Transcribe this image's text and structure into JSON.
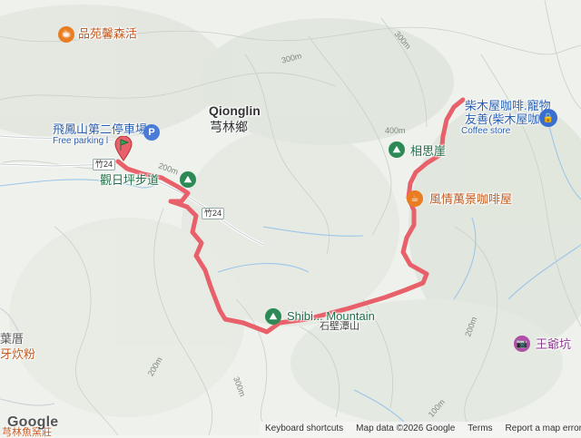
{
  "map": {
    "place_name_en": "Qionglin",
    "place_name_zh": "芎林鄉",
    "pois": {
      "cafe_top_left": "品苑馨森活",
      "parking_zh": "飛鳳山第二停車場",
      "parking_en": "Free parking l",
      "viewpoint": "觀日坪步道",
      "xiangsi": "相思崖",
      "cafe_right": "風情萬景咖啡屋",
      "coffee_store_zh_1": "柴木屋咖啡.寵物",
      "coffee_store_zh_2": "友善(柴木屋咖啡)",
      "coffee_store_en": "Coffee store",
      "mountain_en": "Shibi... Mountain",
      "mountain_zh": "石壁潭山",
      "temple": "王爺坑",
      "left_edge_1": "葉厝",
      "left_edge_2": "牙炊粉",
      "bottom_left": "芎林魚窯莊"
    },
    "roads": {
      "shield_1": "竹24",
      "shield_2": "竹24"
    },
    "contours": [
      "300m",
      "300m",
      "400m",
      "200m",
      "200m",
      "300m",
      "200m",
      "100m"
    ],
    "icons": {
      "cafe": "coffee-cup-icon",
      "parking": "parking-icon",
      "hiking": "hiking-icon",
      "shop": "shopping-bag-icon",
      "camera": "camera-icon",
      "start": "start-flag-icon"
    },
    "colors": {
      "route": "#e8606a",
      "cafe": "#e87d22",
      "hiking": "#2d8a57",
      "parking": "#4a7bd6",
      "shop": "#3a6fd0",
      "camera": "#b04fa8"
    }
  },
  "footer": {
    "brand": "Google",
    "keyboard": "Keyboard shortcuts",
    "mapdata": "Map data ©2026 Google",
    "terms": "Terms",
    "report": "Report a map error"
  }
}
